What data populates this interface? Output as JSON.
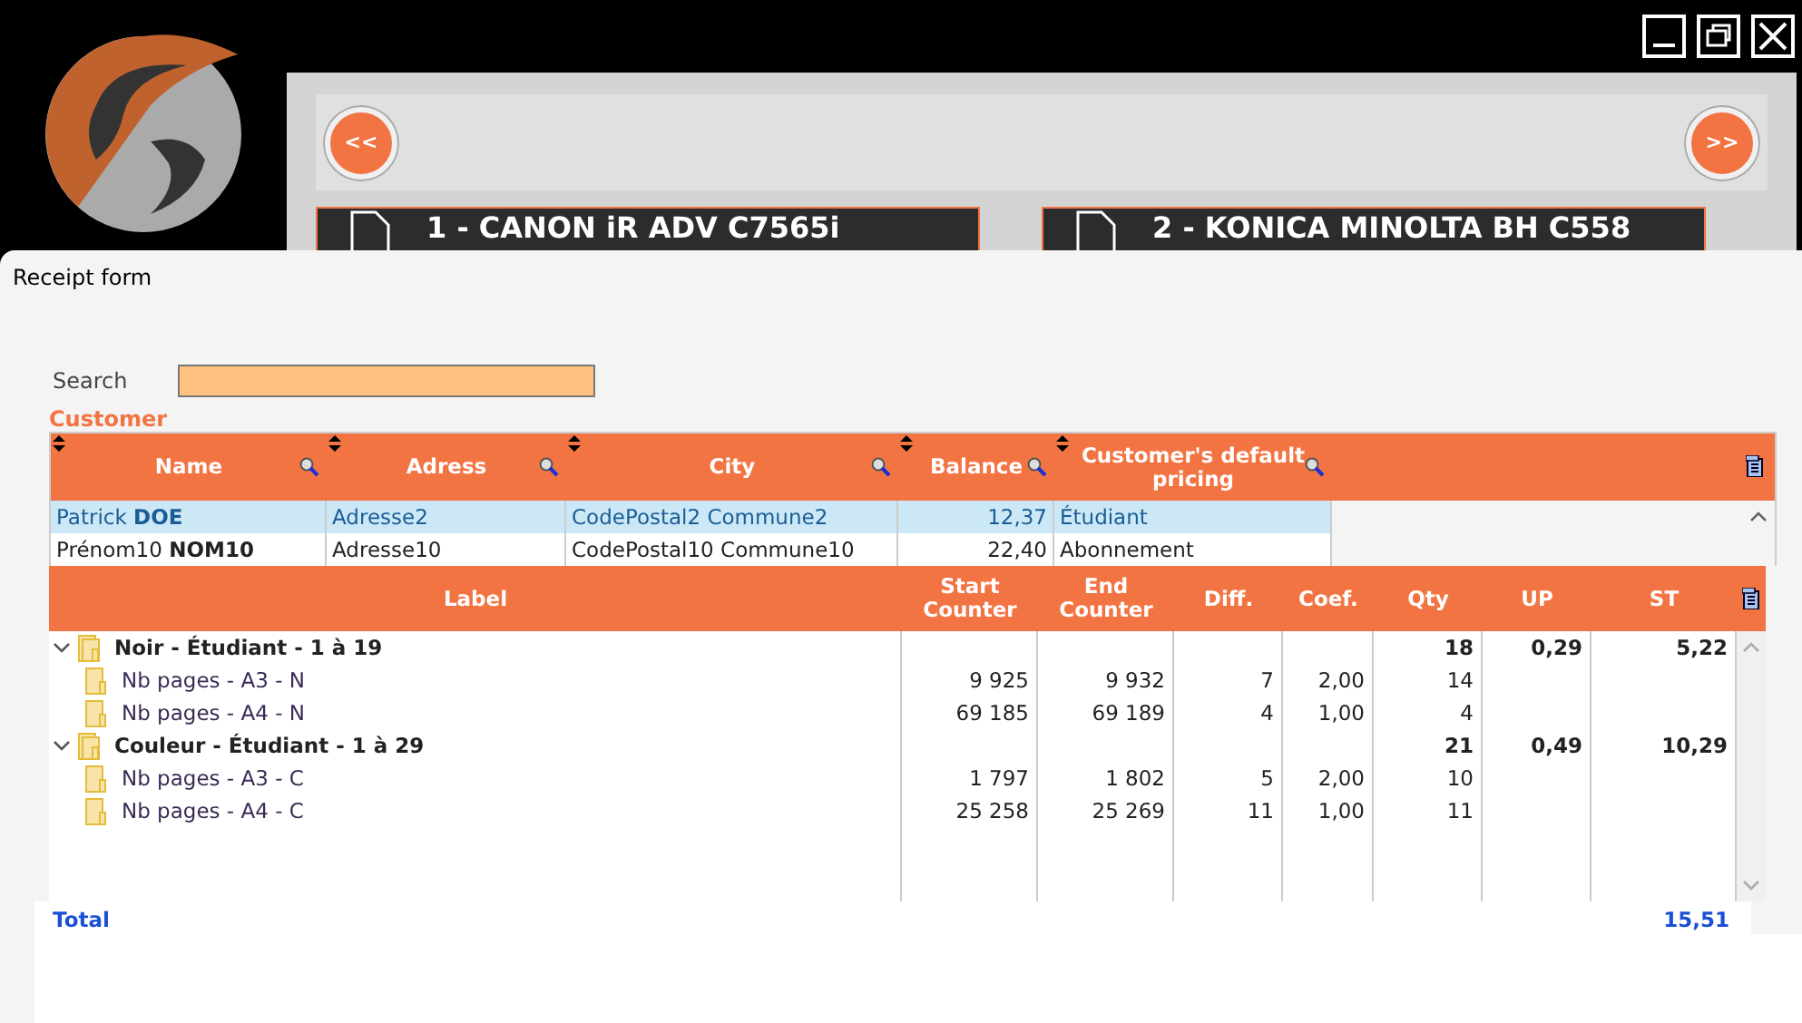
{
  "nav": {
    "prev": "<<",
    "next": ">>"
  },
  "devices": [
    {
      "label": "1 - CANON iR ADV C7565i"
    },
    {
      "label": "2 - KONICA MINOLTA BH C558"
    }
  ],
  "dialog": {
    "title": "Receipt form"
  },
  "search": {
    "label": "Search"
  },
  "customer": {
    "title": "Customer",
    "columns": [
      "Name",
      "Adress",
      "City",
      "Balance",
      "Customer's default pricing"
    ],
    "rows": [
      {
        "selected": true,
        "cells": [
          "Patrick **DOE**",
          "Adresse2",
          "CodePostal2 Commune2",
          "12,37",
          "Étudiant"
        ]
      },
      {
        "selected": false,
        "cells": [
          "Prénom10 **NOM10**",
          "Adresse10",
          "CodePostal10 Commune10",
          "22,40",
          "Abonnement"
        ]
      }
    ]
  },
  "detail": {
    "columns": [
      "Label",
      "Start Counter",
      "End Counter",
      "Diff.",
      "Coef.",
      "Qty",
      "UP",
      "ST"
    ],
    "groups": [
      {
        "label": "Noir - Étudiant - 1 à 19",
        "expanded": true,
        "qty": "18",
        "up": "0,29",
        "st": "5,22",
        "children": [
          {
            "label": "Nb pages - A3 - N",
            "start": "9 925",
            "end": "9 932",
            "diff": "7",
            "coef": "2,00",
            "qty": "14"
          },
          {
            "label": "Nb pages - A4 - N",
            "start": "69 185",
            "end": "69 189",
            "diff": "4",
            "coef": "1,00",
            "qty": "4"
          }
        ]
      },
      {
        "label": "Couleur - Étudiant - 1 à 29",
        "expanded": true,
        "qty": "21",
        "up": "0,49",
        "st": "10,29",
        "children": [
          {
            "label": "Nb pages - A3 - C",
            "start": "1 797",
            "end": "1 802",
            "diff": "5",
            "coef": "2,00",
            "qty": "10"
          },
          {
            "label": "Nb pages - A4 - C",
            "start": "25 258",
            "end": "25 269",
            "diff": "11",
            "coef": "1,00",
            "qty": "11"
          }
        ]
      }
    ],
    "total": {
      "label": "Total",
      "value": "15,51"
    }
  }
}
